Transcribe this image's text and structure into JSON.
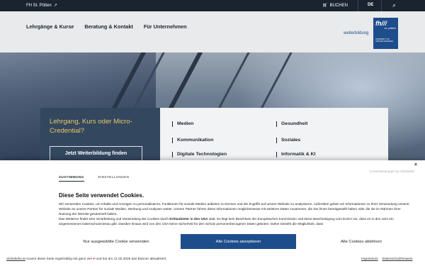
{
  "topbar": {
    "site_label": "FH St. Pölten",
    "external_icon": "external-link-icon",
    "cart_label": "BUCHEN",
    "cart_icon": "cart-icon",
    "language": "DE",
    "search_icon": "search-icon"
  },
  "header": {
    "nav": [
      "Lehrgänge & Kurse",
      "Beratung & Kontakt",
      "Für Unternehmen"
    ],
    "weiterbildung_label": "weiterbildung",
    "logo": {
      "main": "fh///",
      "sub": "st. pölten",
      "tagline": "UNIVERSITY OF APPLIED SCIENCES"
    }
  },
  "hero": {
    "promo_title": "Lehrgang, Kurs oder Micro-Credential?",
    "promo_button": "Jetzt Weiterbildung finden",
    "categories": [
      "Medien",
      "Gesundheit",
      "Kommunikation",
      "Soziales",
      "Digitale Technologien",
      "Informatik & KI"
    ]
  },
  "cookie": {
    "close_label": "×",
    "tabs": [
      "ZUSTIMMUNG",
      "EINSTELLUNGEN"
    ],
    "powered_by": "Consentmanager by clickskeks",
    "title": "Diese Seite verwendet Cookies.",
    "paragraph_1": "Wir verwenden Cookies, um Inhalte und Anzeigen zu personalisieren, Funktionen für soziale Medien anbieten zu können und die Zugriffe auf unsere Website zu analysieren. Außerdem geben wir Informationen zu Ihrer Verwendung unserer Website an unsere Partner für soziale Medien, Werbung und Analysen weiter. Unsere Partner führen diese Informationen möglicherweise mit weiteren Daten zusammen, die Sie ihnen bereitgestellt haben oder die sie im Rahmen Ihrer Nutzung der Dienste gesammelt haben.",
    "paragraph_2_pre": "Das Weiteren findet eine Verarbeitung und Verwendung der Cookies durch ",
    "paragraph_2_bold": "Drittanbieter in den USA",
    "paragraph_2_post": " statt. Es liegt kein Beschluss der Europäischen Kommission und keine Bescheinigung vom EuGH vor, dass es in den USA ein angemessenes Datenschutzniveau gibt. Darüber hinaus wird von den USA keine Sicherheit für den Schutz personenbezogener Daten geboten. Daher besteht die Möglichkeit, dass",
    "btn_selected": "Nur ausgewählte Cookie verwenden",
    "btn_accept": "Alle Cookies akzeptieren",
    "btn_deny": "Alle Cookies ablehnen",
    "footer_link": "clickskeks.at",
    "footer_pre": " scannt diese Seite regelmäßig mit ganz viel ",
    "footer_heart": "♥",
    "footer_post": " und hat am 11.02.2025 das Banner aktualisiert.",
    "footer_imprint": "Impressum",
    "footer_privacy": "Datenschutzhinweis"
  }
}
